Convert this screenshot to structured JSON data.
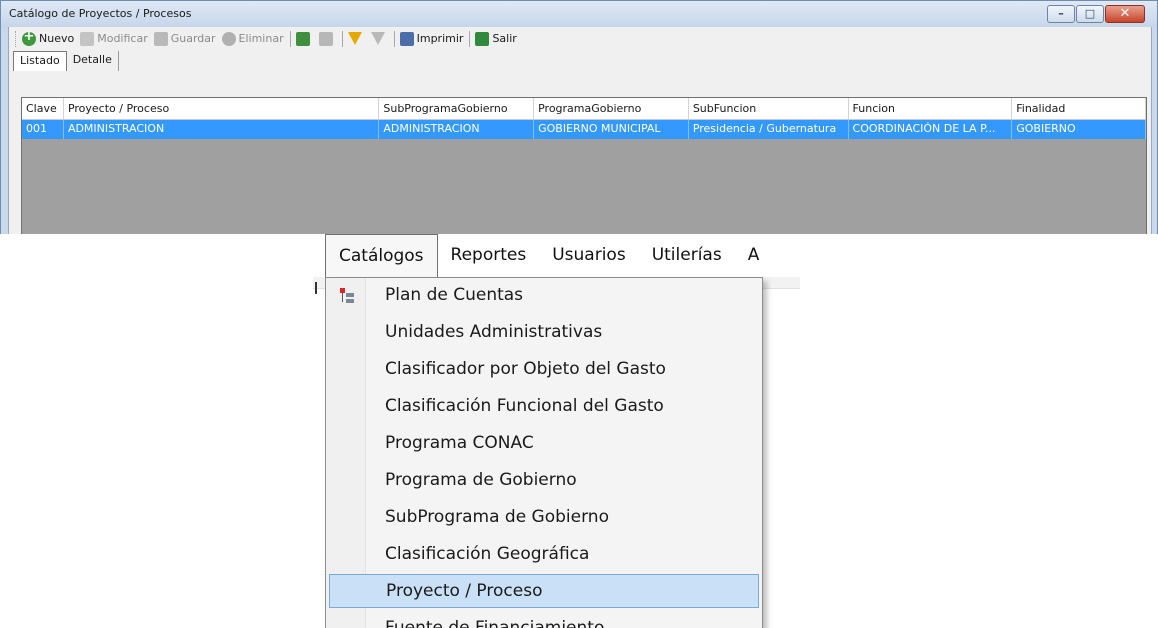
{
  "window": {
    "title": "Catálogo de Proyectos / Procesos",
    "controls": {
      "minimize": "–",
      "maximize": "□",
      "close": "✕"
    }
  },
  "toolbar": {
    "nuevo": "Nuevo",
    "modificar": "Modificar",
    "guardar": "Guardar",
    "eliminar": "Eliminar",
    "imprimir": "Imprimir",
    "salir": "Salir"
  },
  "tabs": {
    "listado": "Listado",
    "detalle": "Detalle"
  },
  "grid": {
    "columns": [
      "Clave",
      "Proyecto / Proceso",
      "SubProgramaGobierno",
      "ProgramaGobierno",
      "SubFuncion",
      "Funcion",
      "Finalidad"
    ],
    "rows": [
      [
        "001",
        "ADMINISTRACION",
        "ADMINISTRACION",
        "GOBIERNO MUNICIPAL",
        "Presidencia / Gubernatura",
        "COORDINACIÓN DE LA P...",
        "GOBIERNO"
      ]
    ]
  },
  "menubar": {
    "items": [
      "Catálogos",
      "Reportes",
      "Usuarios",
      "Utilerías",
      "A"
    ]
  },
  "dropdown": {
    "items": [
      "Plan de Cuentas",
      "Unidades Administrativas",
      "Clasificador por Objeto del Gasto",
      "Clasificación Funcional del Gasto",
      "Programa CONAC",
      "Programa de Gobierno",
      "SubPrograma de Gobierno",
      "Clasificación Geográfica",
      "Proyecto / Proceso",
      "Fuente de Financiamiento"
    ],
    "highlighted": "Proyecto / Proceso"
  }
}
